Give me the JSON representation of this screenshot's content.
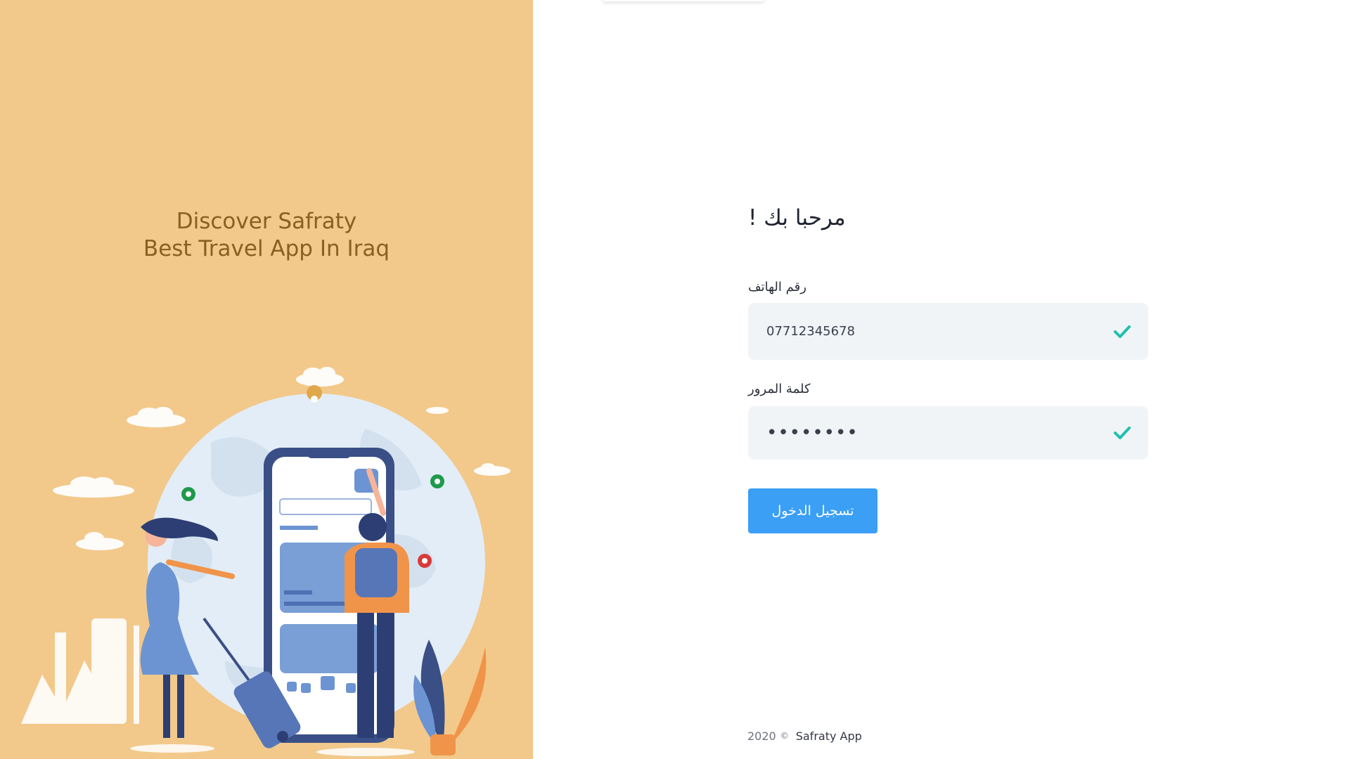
{
  "tagline": {
    "line1": "Discover Safraty",
    "line2": "Best Travel App In Iraq"
  },
  "form": {
    "welcome": "مرحبا بك !",
    "phone_label": "رقم الهاتف",
    "phone_value": "07712345678",
    "password_label": "كلمة المرور",
    "password_value": "••••••••",
    "login_label": "تسجيل الدخول",
    "valid_icon": "checkmark-icon"
  },
  "footer": {
    "year": "2020",
    "copyright": "©",
    "brand": "Safraty App"
  },
  "colors": {
    "panel": "#f2c98b",
    "tagline": "#8a5f1f",
    "button": "#3a9ff5",
    "check": "#1fbfb0",
    "field": "#f1f4f7"
  }
}
